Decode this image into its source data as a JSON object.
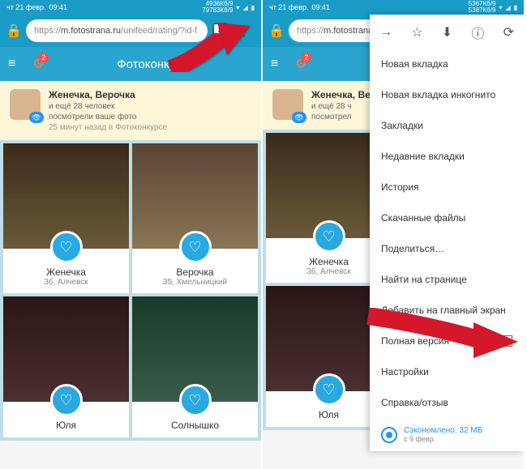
{
  "status": {
    "time_label": "чт 21 февр.",
    "time": "09:41",
    "right1": "4936Кб/9",
    "right2": "79783Кб/9"
  },
  "url": {
    "prefix": "https://",
    "bold": "m.fotostrana.ru",
    "suffix": "/unifeed/rating/?id-f",
    "bold2": "m.fotostrana.r",
    "tab_count": "8"
  },
  "header": {
    "title": "Фотоконкурс",
    "badge": "2"
  },
  "notice": {
    "title": "Женечка, Верочка",
    "sub1": "и ещё 28 человек",
    "sub2": "посмотрели ваше фото",
    "sub3": "25 минут назад в Фотоконкурсе",
    "sub1_short": "и ещё 28 ч",
    "sub2_short": "посмотрел"
  },
  "cards": [
    {
      "name": "Женечка",
      "loc": "36, Алчевск"
    },
    {
      "name": "Верочка",
      "loc": "35, Хмельницкий"
    },
    {
      "name": "Юля",
      "loc": ""
    },
    {
      "name": "Солнышко",
      "loc": ""
    }
  ],
  "menu": {
    "items": [
      "Новая вкладка",
      "Новая вкладка инкогнито",
      "Закладки",
      "Недавние вкладки",
      "История",
      "Скачанные файлы",
      "Поделиться…",
      "Найти на странице",
      "Добавить на главный экран",
      "Полная версия",
      "Настройки",
      "Справка/отзыв"
    ],
    "saved": "Сэкономлено: 32 МБ",
    "saved_date": "с 9 февр."
  }
}
